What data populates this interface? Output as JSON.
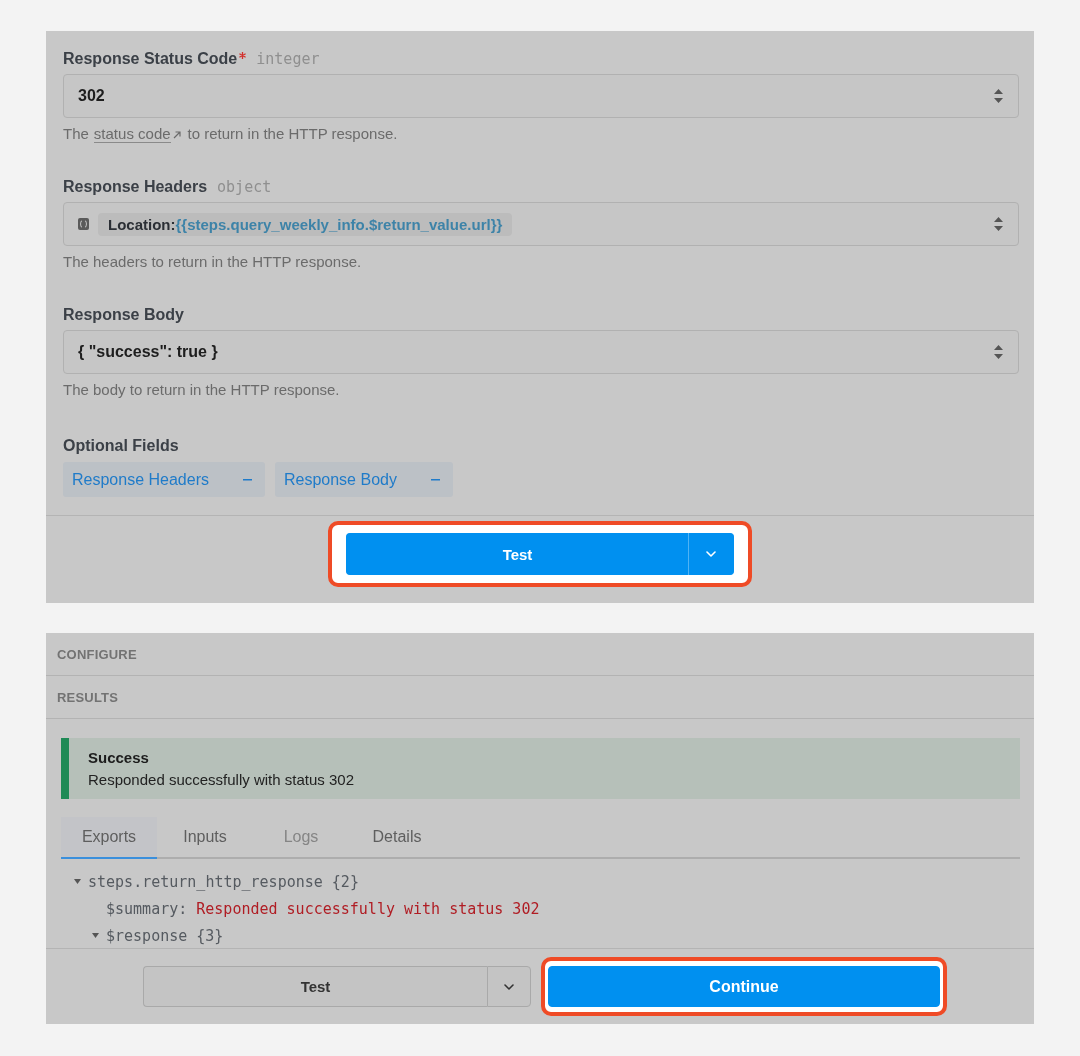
{
  "config_form": {
    "fields": [
      {
        "kind": "value",
        "label": "Response Status Code",
        "required": true,
        "type": "integer",
        "value": "302",
        "help": {
          "text": "The",
          "link": "status code",
          "after": "to return in the HTTP response."
        }
      },
      {
        "kind": "tags",
        "label": "Response Headers",
        "required": false,
        "type": "object",
        "tags": [
          {
            "key": "Location:",
            "value": "{{steps.query_weekly_info.$return_value.url}}"
          }
        ],
        "help": {
          "text": "The headers to return in the HTTP response."
        }
      },
      {
        "kind": "value",
        "label": "Response Body",
        "required": false,
        "value": "{ \"success\": true }",
        "help": {
          "text": "The body to return in the HTTP response."
        }
      }
    ],
    "optional_fields": {
      "label": "Optional Fields",
      "items": [
        {
          "label": "Response Headers"
        },
        {
          "label": "Response Body"
        }
      ]
    },
    "footer": {
      "buttons": [
        {
          "kind": "split",
          "label": "Test",
          "highlighted": true
        }
      ]
    }
  },
  "result_panel": {
    "sections": [
      {
        "label": "CONFIGURE"
      },
      {
        "label": "RESULTS"
      }
    ],
    "alert": {
      "kind": "success",
      "title": "Success",
      "message": "Responded successfully with status 302"
    },
    "tabs": [
      {
        "label": "Exports",
        "selected": true,
        "disabled": false
      },
      {
        "label": "Inputs",
        "selected": false,
        "disabled": false
      },
      {
        "label": "Logs",
        "selected": false,
        "disabled": true
      },
      {
        "label": "Details",
        "selected": false,
        "disabled": false
      }
    ],
    "tree": [
      {
        "kind": "branch",
        "label": "steps.return_http_response {2}",
        "expanded": true,
        "children": [
          {
            "kind": "leaf",
            "key": "$summary:",
            "value": "Responded successfully with status 302"
          },
          {
            "kind": "branch",
            "label": "$response {3}",
            "expanded": true
          }
        ]
      }
    ],
    "footer": {
      "buttons": [
        {
          "kind": "split",
          "label": "Test",
          "highlighted": false
        },
        {
          "kind": "plain",
          "label": "Continue",
          "highlighted": true
        }
      ]
    }
  }
}
